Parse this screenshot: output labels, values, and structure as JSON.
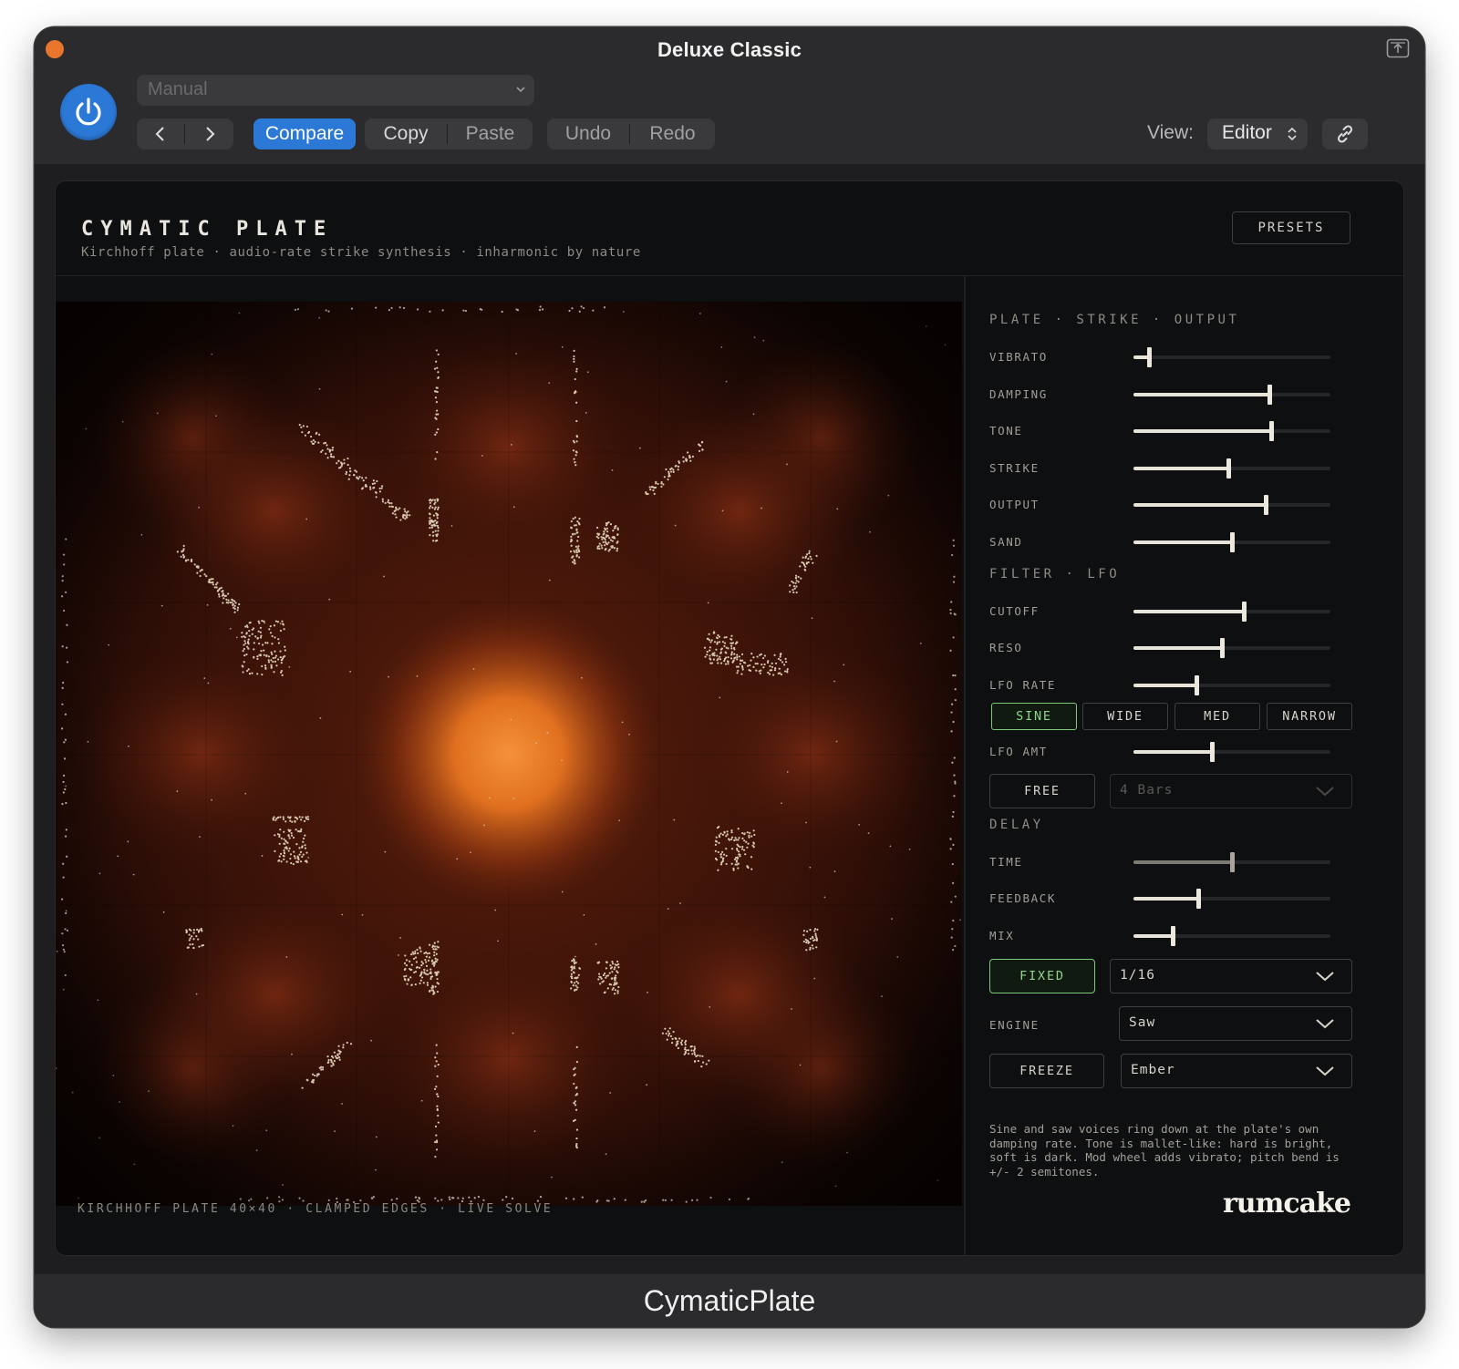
{
  "window": {
    "title": "Deluxe Classic",
    "footer_name": "CymaticPlate"
  },
  "host": {
    "preset_placeholder": "Manual",
    "compare_label": "Compare",
    "copy_label": "Copy",
    "paste_label": "Paste",
    "undo_label": "Undo",
    "redo_label": "Redo",
    "view_label": "View:",
    "view_value": "Editor"
  },
  "plugin": {
    "title": "CYMATIC PLATE",
    "subtitle": "Kirchhoff plate · audio-rate strike synthesis · inharmonic by nature",
    "presets_label": "PRESETS",
    "viz_caption": "KIRCHHOFF PLATE 40×40 · CLAMPED EDGES · LIVE SOLVE",
    "accent_color": "#e8772d",
    "active_green": "#8fd68a",
    "sections": {
      "plate": "PLATE · STRIKE · OUTPUT",
      "filter": "FILTER · LFO",
      "delay": "DELAY"
    },
    "sliders": {
      "vibrato": {
        "label": "VIBRATO",
        "value": 0.08
      },
      "damping": {
        "label": "DAMPING",
        "value": 0.69
      },
      "tone": {
        "label": "TONE",
        "value": 0.7
      },
      "strike": {
        "label": "STRIKE",
        "value": 0.48
      },
      "output": {
        "label": "OUTPUT",
        "value": 0.67
      },
      "sand": {
        "label": "SAND",
        "value": 0.5
      },
      "cutoff": {
        "label": "CUTOFF",
        "value": 0.56
      },
      "reso": {
        "label": "RESO",
        "value": 0.45
      },
      "lfo_rate": {
        "label": "LFO RATE",
        "value": 0.32
      },
      "lfo_amt": {
        "label": "LFO AMT",
        "value": 0.4
      },
      "time": {
        "label": "TIME",
        "value": 0.5
      },
      "feedback": {
        "label": "FEEDBACK",
        "value": 0.33
      },
      "mix": {
        "label": "MIX",
        "value": 0.2
      }
    },
    "lfo_shapes": [
      "SINE",
      "WIDE",
      "MED",
      "NARROW"
    ],
    "lfo_shape_selected": "SINE",
    "lfo_sync": {
      "label": "FREE",
      "value": "4 Bars"
    },
    "delay_sync": {
      "label": "FIXED",
      "value": "1/16"
    },
    "engine": {
      "label": "ENGINE",
      "value": "Saw"
    },
    "freeze": {
      "label": "FREEZE",
      "value": "Ember"
    },
    "note": "Sine and saw voices ring down at the plate's own damping rate. Tone is mallet-like: hard is bright, soft is dark. Mod wheel adds vibrato; pitch bend is +/- 2 semitones.",
    "brand": "rumcake"
  }
}
